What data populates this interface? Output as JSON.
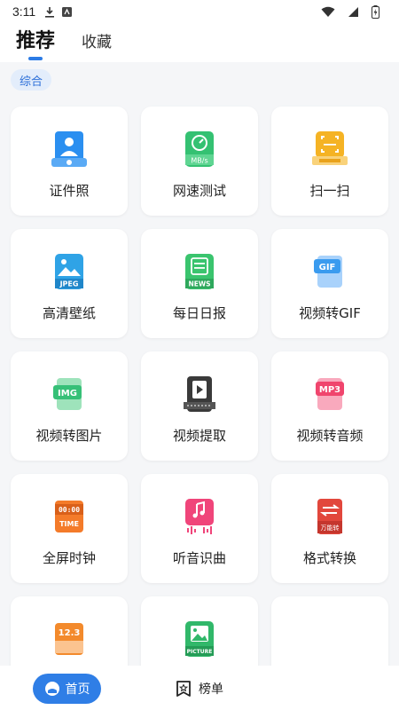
{
  "status_bar": {
    "time": "3:11"
  },
  "tabs": [
    {
      "label": "推荐",
      "active": true
    },
    {
      "label": "收藏",
      "active": false
    }
  ],
  "category_chip": "综合",
  "tools": [
    {
      "label": "证件照",
      "icon": "id-photo-icon",
      "color": "#2b8ff0"
    },
    {
      "label": "网速测试",
      "icon": "speed-test-icon",
      "color": "#34c172"
    },
    {
      "label": "扫一扫",
      "icon": "scan-icon",
      "color": "#f5b324"
    },
    {
      "label": "高清壁纸",
      "icon": "wallpaper-icon",
      "color": "#2fa3e6"
    },
    {
      "label": "每日日报",
      "icon": "daily-news-icon",
      "color": "#3ac46e"
    },
    {
      "label": "视频转GIF",
      "icon": "gif-icon",
      "color": "#3a9bef"
    },
    {
      "label": "视频转图片",
      "icon": "img-icon",
      "color": "#36c077"
    },
    {
      "label": "视频提取",
      "icon": "video-extract-icon",
      "color": "#3a3a3a"
    },
    {
      "label": "视频转音频",
      "icon": "mp3-icon",
      "color": "#f0456d"
    },
    {
      "label": "全屏时钟",
      "icon": "clock-icon",
      "color": "#f47b2a"
    },
    {
      "label": "听音识曲",
      "icon": "music-recognition-icon",
      "color": "#f0457a"
    },
    {
      "label": "格式转换",
      "icon": "format-convert-icon",
      "color": "#e2473c"
    },
    {
      "label": "",
      "icon": "calculator-icon",
      "color": "#f38a2c"
    },
    {
      "label": "",
      "icon": "picture-icon",
      "color": "#31b86a"
    },
    {
      "label": "",
      "icon": "",
      "color": ""
    }
  ],
  "icon_text": {
    "speed": "MB/s",
    "wallpaper": "JPEG",
    "news": "NEWS",
    "gif": "GIF",
    "img": "IMG",
    "mp3": "MP3",
    "clock_top": "00:00",
    "clock_bottom": "TIME",
    "convert": "万能转",
    "calc": "12.3",
    "picture": "PICTURE"
  },
  "bottom_nav": {
    "home": "首页",
    "rank": "榜单"
  },
  "accent_color": "#2f7ee6"
}
